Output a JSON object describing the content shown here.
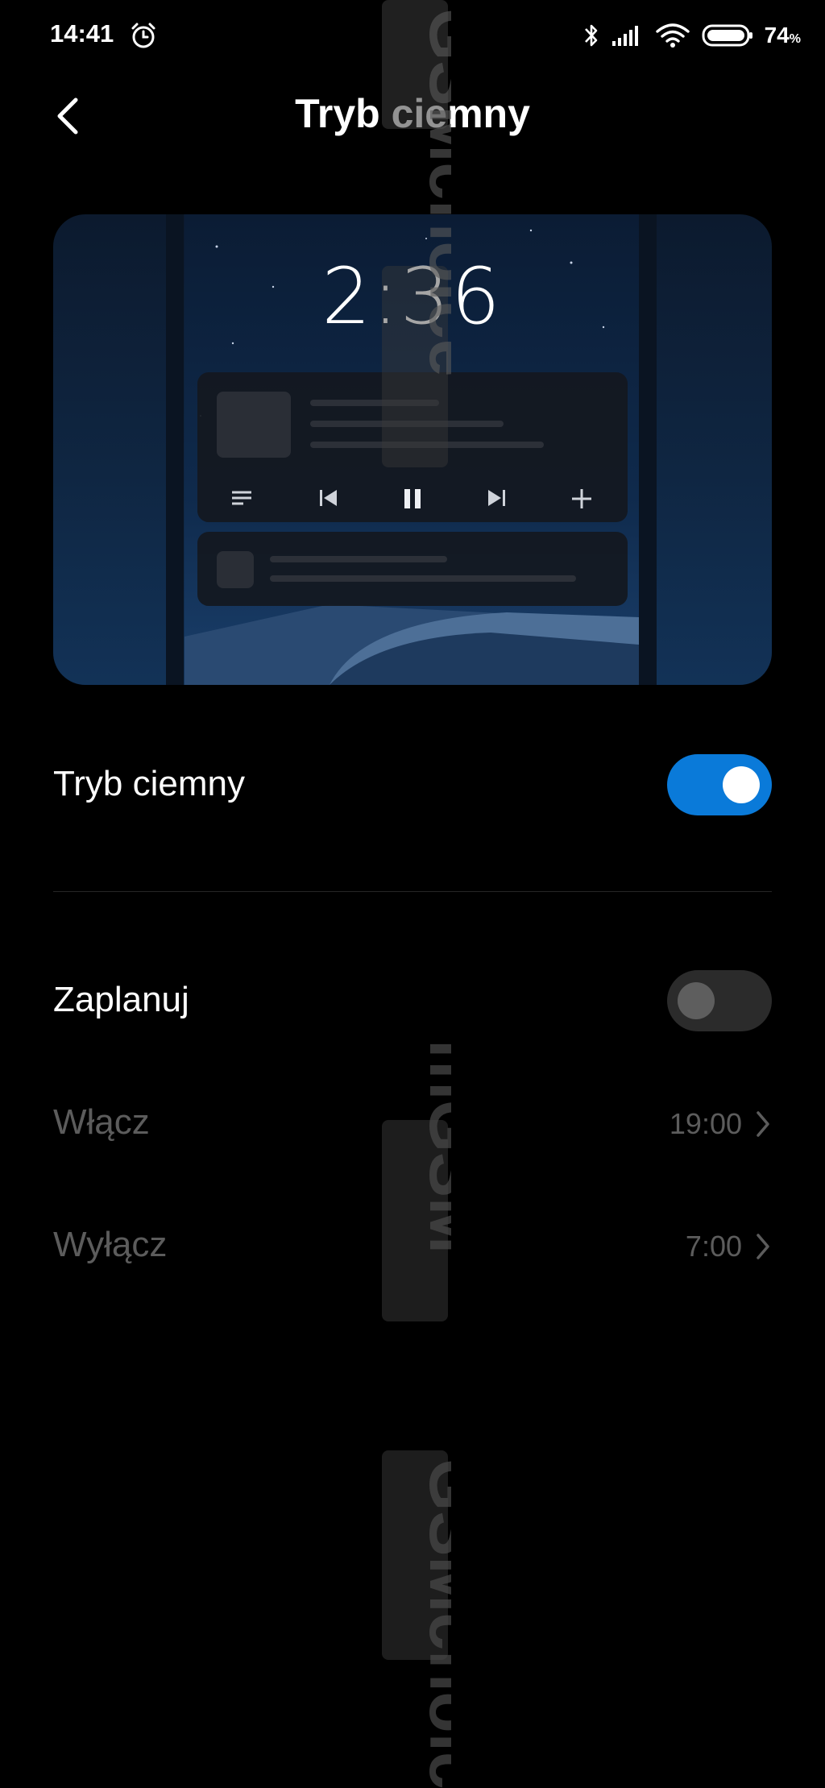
{
  "status_bar": {
    "time": "14:41",
    "battery_percent": "74",
    "battery_unit": "%"
  },
  "header": {
    "title": "Tryb ciemny"
  },
  "preview": {
    "clock": "2:36"
  },
  "settings": {
    "dark_mode": {
      "label": "Tryb ciemny",
      "enabled": true
    },
    "schedule": {
      "label": "Zaplanuj",
      "enabled": false
    },
    "turn_on": {
      "label": "Włącz",
      "value": "19:00"
    },
    "turn_off": {
      "label": "Wyłącz",
      "value": "7:00"
    }
  },
  "watermarks": [
    "GSMchoice",
    "mGSM",
    "GSMchoice"
  ],
  "colors": {
    "accent": "#0a7ad9",
    "background": "#000000",
    "disabled_text": "#5c5c5c"
  }
}
